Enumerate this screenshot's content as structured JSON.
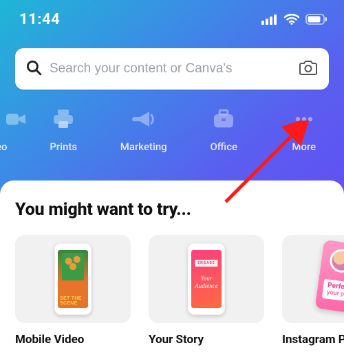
{
  "status": {
    "time": "11:44"
  },
  "search": {
    "placeholder": "Search your content or Canva's"
  },
  "categories": [
    {
      "id": "video",
      "label": "eo",
      "icon": "video-icon",
      "partial": true
    },
    {
      "id": "prints",
      "label": "Prints",
      "icon": "printer-icon"
    },
    {
      "id": "marketing",
      "label": "Marketing",
      "icon": "megaphone-icon"
    },
    {
      "id": "office",
      "label": "Office",
      "icon": "briefcase-icon"
    },
    {
      "id": "more",
      "label": "More",
      "icon": "more-icon"
    }
  ],
  "sheet": {
    "title": "You might want to try...",
    "cards": [
      {
        "id": "mobile-video",
        "label": "Mobile Video",
        "mock": {
          "text1": "SET THE",
          "text2": "SCENE"
        }
      },
      {
        "id": "your-story",
        "label": "Your Story",
        "mock": {
          "tag": "ENGAGE",
          "line1": "Your",
          "line2": "Audience"
        }
      },
      {
        "id": "instagram-post",
        "label": "Instagram P",
        "mock": {
          "line1": "Perfect",
          "line2": "your p"
        }
      }
    ]
  },
  "annotation": {
    "target": "more",
    "type": "arrow",
    "color": "#ff1a1a"
  }
}
